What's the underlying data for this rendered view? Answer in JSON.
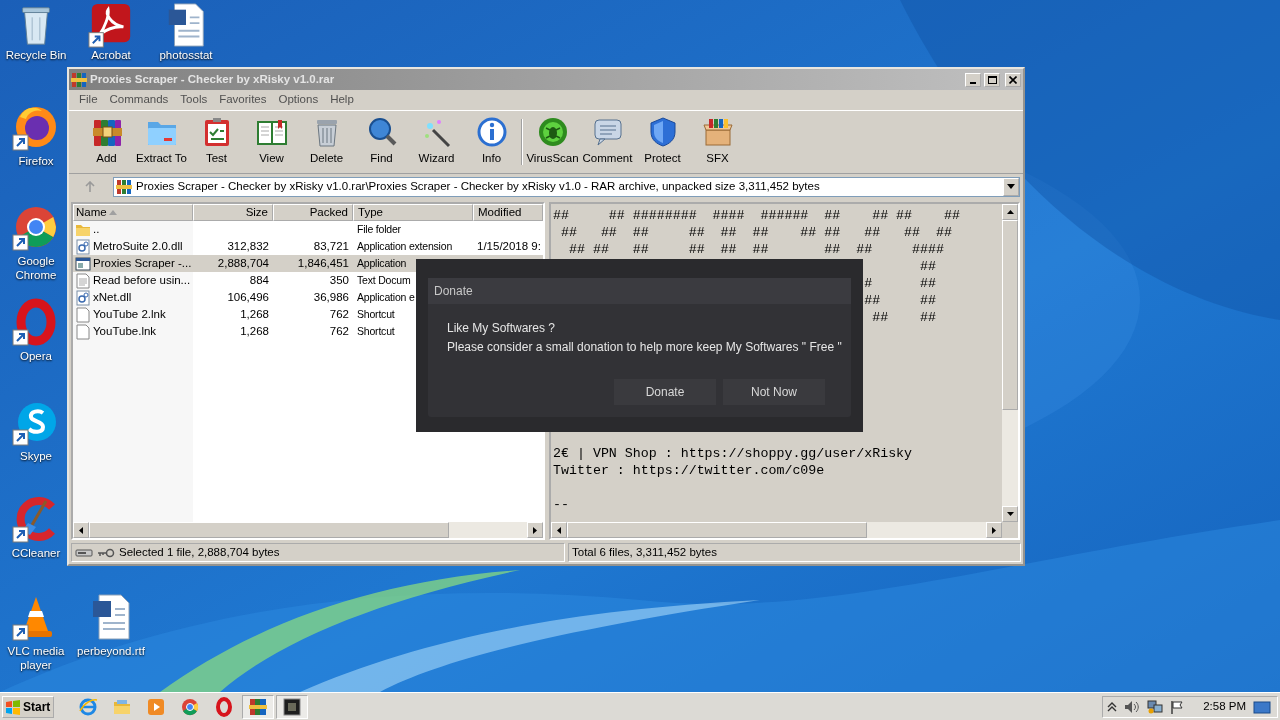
{
  "desktop_icons": [
    {
      "label": "Recycle Bin",
      "kind": "recycle",
      "shortcut": false
    },
    {
      "label": "Acrobat",
      "kind": "acrobat",
      "shortcut": true
    },
    {
      "label": "photosstat",
      "kind": "document",
      "shortcut": false
    },
    {
      "label": "Firefox",
      "kind": "firefox",
      "shortcut": true
    },
    {
      "label": "Google Chrome",
      "kind": "chrome",
      "shortcut": true
    },
    {
      "label": "Opera",
      "kind": "opera",
      "shortcut": true
    },
    {
      "label": "Skype",
      "kind": "skype",
      "shortcut": true
    },
    {
      "label": "CCleaner",
      "kind": "ccleaner",
      "shortcut": true
    },
    {
      "label": "VLC media player",
      "kind": "vlc",
      "shortcut": true
    },
    {
      "label": "perbeyond.rtf",
      "kind": "document",
      "shortcut": false
    }
  ],
  "window": {
    "title": "Proxies Scraper - Checker by xRisky v1.0.rar",
    "active": false,
    "menu": [
      "File",
      "Commands",
      "Tools",
      "Favorites",
      "Options",
      "Help"
    ],
    "toolbar": [
      {
        "label": "Add",
        "separator_before": false
      },
      {
        "label": "Extract To",
        "separator_before": false
      },
      {
        "label": "Test",
        "separator_before": false
      },
      {
        "label": "View",
        "separator_before": false
      },
      {
        "label": "Delete",
        "separator_before": false
      },
      {
        "label": "Find",
        "separator_before": false
      },
      {
        "label": "Wizard",
        "separator_before": false
      },
      {
        "label": "Info",
        "separator_before": false
      },
      {
        "label": "VirusScan",
        "separator_before": true
      },
      {
        "label": "Comment",
        "separator_before": false
      },
      {
        "label": "Protect",
        "separator_before": false
      },
      {
        "label": "SFX",
        "separator_before": false
      }
    ],
    "address": "Proxies Scraper - Checker by xRisky v1.0.rar\\Proxies Scraper - Checker by xRisky v1.0 - RAR archive, unpacked size 3,311,452 bytes",
    "table": {
      "columns": [
        "Name",
        "Size",
        "Packed",
        "Type",
        "Modified"
      ],
      "rows": [
        {
          "kind": "folder",
          "selected": false,
          "cells": [
            "..",
            "",
            "",
            "File folder",
            ""
          ]
        },
        {
          "kind": "dll",
          "selected": false,
          "cells": [
            "MetroSuite 2.0.dll",
            "312,832",
            "83,721",
            "Application extension",
            "1/15/2018 9:"
          ]
        },
        {
          "kind": "exe",
          "selected": true,
          "cells": [
            "Proxies Scraper -...",
            "2,888,704",
            "1,846,451",
            "Application",
            ""
          ]
        },
        {
          "kind": "text",
          "selected": false,
          "cells": [
            "Read before usin...",
            "884",
            "350",
            "Text Docum",
            ""
          ]
        },
        {
          "kind": "dll",
          "selected": false,
          "cells": [
            "xNet.dll",
            "106,496",
            "36,986",
            "Application e",
            ""
          ]
        },
        {
          "kind": "file",
          "selected": false,
          "cells": [
            "YouTube 2.lnk",
            "1,268",
            "762",
            "Shortcut",
            ""
          ]
        },
        {
          "kind": "file",
          "selected": false,
          "cells": [
            "YouTube.lnk",
            "1,268",
            "762",
            "Shortcut",
            ""
          ]
        }
      ]
    },
    "comment": {
      "ascii_art": [
        "##     ## ########  ####  ######  ##    ## ##    ##",
        " ##   ##  ##     ##  ##  ##    ## ##   ##   ##  ##",
        "  ## ##   ##     ##  ##  ##       ##  ##     ####",
        "                                              ##",
        "                                       #      ##",
        "                                       ##     ##",
        "                                        ##    ##"
      ],
      "lines": [
        "2€ | VPN Shop : https://shoppy.gg/user/xRisky",
        "Twitter : https://twitter.com/c09e",
        "--"
      ]
    },
    "status_bar": {
      "left": "Selected 1 file, 2,888,704 bytes",
      "right": "Total 6 files, 3,311,452 bytes"
    }
  },
  "dialog": {
    "title": "Donate",
    "message": [
      "Like My Softwares ?",
      "Please consider a small donation to help more keep My Softwares \" Free \""
    ],
    "buttons": [
      "Donate",
      "Not Now"
    ]
  },
  "taskbar": {
    "start": "Start",
    "apps": [
      {
        "kind": "ie",
        "active": false
      },
      {
        "kind": "explorer",
        "active": false
      },
      {
        "kind": "media",
        "active": false
      },
      {
        "kind": "chrome",
        "active": false
      },
      {
        "kind": "opera",
        "active": false
      },
      {
        "kind": "winrar",
        "active": true
      },
      {
        "kind": "console",
        "active": true
      }
    ],
    "clock": "2:58 PM"
  }
}
